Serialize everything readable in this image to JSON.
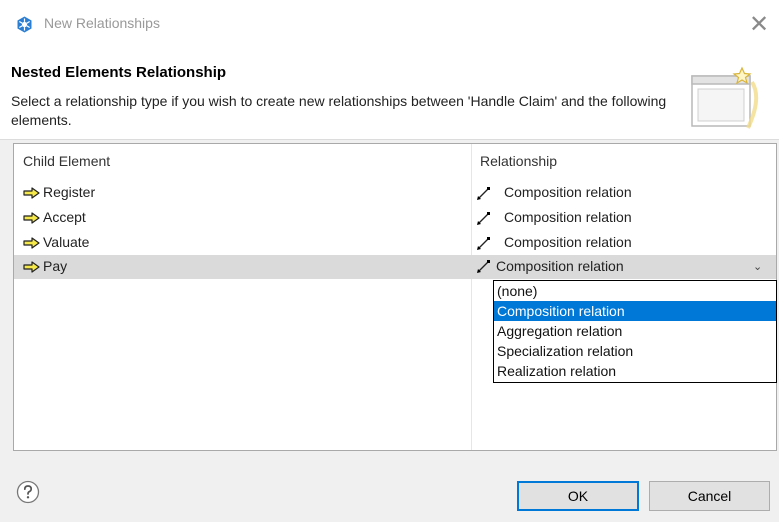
{
  "window": {
    "title": "New Relationships",
    "close_glyph": "✕"
  },
  "header": {
    "title": "Nested Elements Relationship",
    "description": "Select a relationship type if you wish to create new relationships between 'Handle Claim' and the following elements."
  },
  "table": {
    "columns": [
      "Child Element",
      "Relationship"
    ],
    "rows": [
      {
        "child": "Register",
        "relationship": "Composition relation",
        "selected": false
      },
      {
        "child": "Accept",
        "relationship": "Composition relation",
        "selected": false
      },
      {
        "child": "Valuate",
        "relationship": "Composition relation",
        "selected": false
      },
      {
        "child": "Pay",
        "relationship": "Composition relation",
        "selected": true
      }
    ]
  },
  "dropdown": {
    "chevron_glyph": "⌄",
    "options": [
      "(none)",
      "Composition relation",
      "Aggregation relation",
      "Specialization relation",
      "Realization relation"
    ],
    "highlighted": "Composition relation"
  },
  "footer": {
    "ok_label": "OK",
    "cancel_label": "Cancel"
  },
  "icons": {
    "app": "gear-snowflake-icon",
    "header": "window-wizard-icon",
    "arrow": "yellow-arrow-icon",
    "relation": "composition-line-icon",
    "help": "help-icon"
  },
  "colors": {
    "selection_highlight": "#0078d7",
    "selected_row": "#dadada",
    "app_icon": "#2a7fd4"
  }
}
